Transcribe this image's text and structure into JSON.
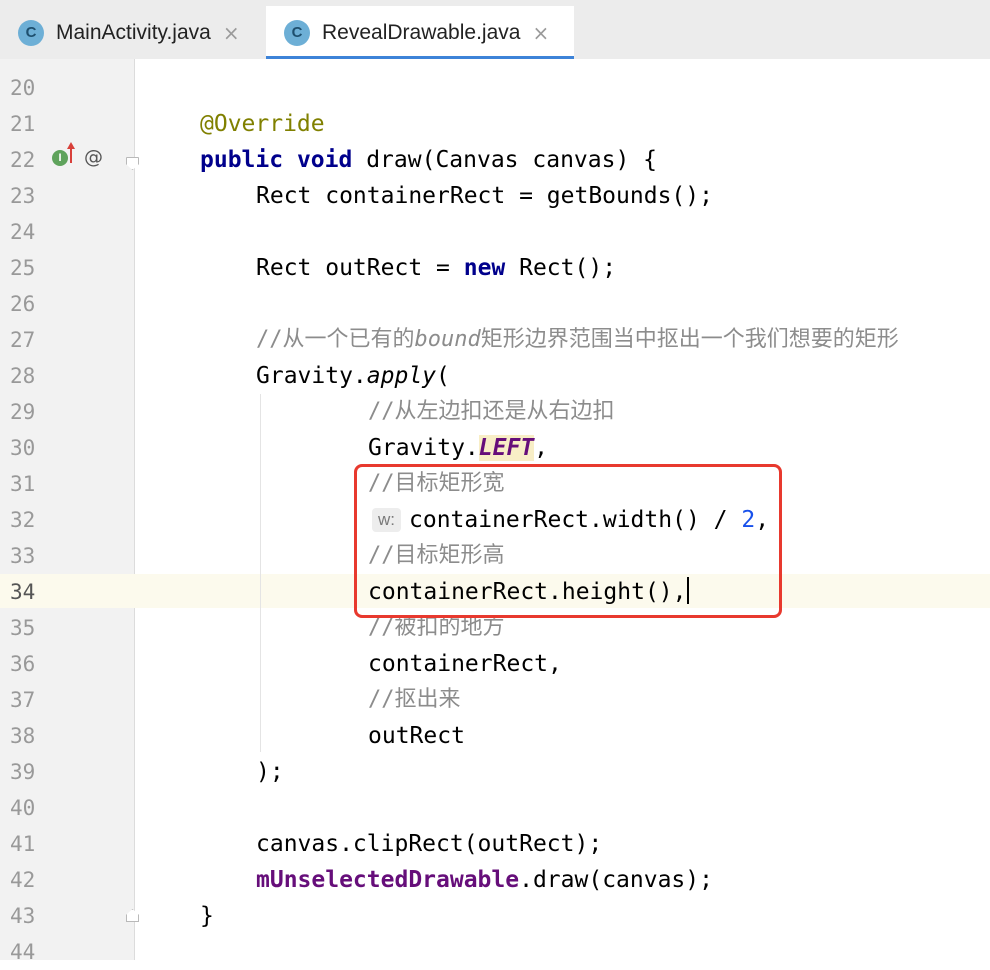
{
  "tabs": [
    {
      "icon_letter": "C",
      "title": "MainActivity.java",
      "close": "×"
    },
    {
      "icon_letter": "C",
      "title": "RevealDrawable.java",
      "close": "×"
    }
  ],
  "gutter": {
    "at_symbol": "@",
    "override_letter": "I"
  },
  "editor": {
    "current_line": "34",
    "lines": [
      {
        "n": "20"
      },
      {
        "n": "21",
        "annotation": "@Override"
      },
      {
        "n": "22",
        "kw1": "public",
        "kw2": "void",
        "text": "draw(Canvas canvas) {"
      },
      {
        "n": "23",
        "text": "Rect containerRect = getBounds();"
      },
      {
        "n": "24"
      },
      {
        "n": "25",
        "text_a": "Rect outRect = ",
        "kw": "new",
        "text_b": " Rect();"
      },
      {
        "n": "26"
      },
      {
        "n": "27",
        "comment_a": "//从一个已有的",
        "comment_italic": "bound",
        "comment_b": "矩形边界范围当中抠出一个我们想要的矩形"
      },
      {
        "n": "28",
        "text_a": "Gravity.",
        "method_italic": "apply",
        "text_b": "("
      },
      {
        "n": "29",
        "comment": "//从左边扣还是从右边扣"
      },
      {
        "n": "30",
        "text_a": "Gravity.",
        "static_field": "LEFT",
        "text_b": ","
      },
      {
        "n": "31",
        "comment": "//目标矩形宽"
      },
      {
        "n": "32",
        "hint": "w:",
        "text_a": "containerRect.width() / ",
        "number": "2",
        "text_b": ","
      },
      {
        "n": "33",
        "comment": "//目标矩形高"
      },
      {
        "n": "34",
        "text": "containerRect.height(),"
      },
      {
        "n": "35",
        "comment": "//被扣的地方"
      },
      {
        "n": "36",
        "text": "containerRect,"
      },
      {
        "n": "37",
        "comment": "//抠出来"
      },
      {
        "n": "38",
        "text": "outRect"
      },
      {
        "n": "39",
        "text": ");"
      },
      {
        "n": "40"
      },
      {
        "n": "41",
        "text": "canvas.clipRect(outRect);"
      },
      {
        "n": "42",
        "field": "mUnselectedDrawable",
        "text": ".draw(canvas);"
      },
      {
        "n": "43",
        "text": "}"
      },
      {
        "n": "44"
      }
    ]
  },
  "colors": {
    "accent": "#3d83d8",
    "highlight_border": "#e8392e",
    "current_line_bg": "#fcfaed"
  }
}
